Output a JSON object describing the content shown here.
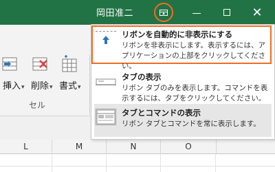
{
  "titlebar": {
    "user_name": "岡田准二",
    "close_glyph": "✕",
    "accent_color": "#217346",
    "highlight_color": "#f26c20"
  },
  "ribbon": {
    "insert_label": "挿入",
    "delete_label": "削除",
    "format_label": "書式",
    "group_label": "セル"
  },
  "sheet": {
    "columns": [
      "L",
      "M",
      "N",
      "O"
    ]
  },
  "menu": {
    "items": [
      {
        "title": "リボンを自動的に非表示にする",
        "desc": "リボンを非表示にします。表示するには、ア\nプリケーションの上部をクリックしてください。",
        "icon": "auto-hide-ribbon-icon"
      },
      {
        "title": "タブの表示",
        "desc": "リボン タブのみを表示します。コマンドを表\n示するには、タブをクリックしてください。",
        "icon": "show-tabs-icon"
      },
      {
        "title": "タブとコマンドの表示",
        "desc": "リボン タブとコマンドを常に表示します。",
        "icon": "show-tabs-commands-icon"
      }
    ]
  }
}
